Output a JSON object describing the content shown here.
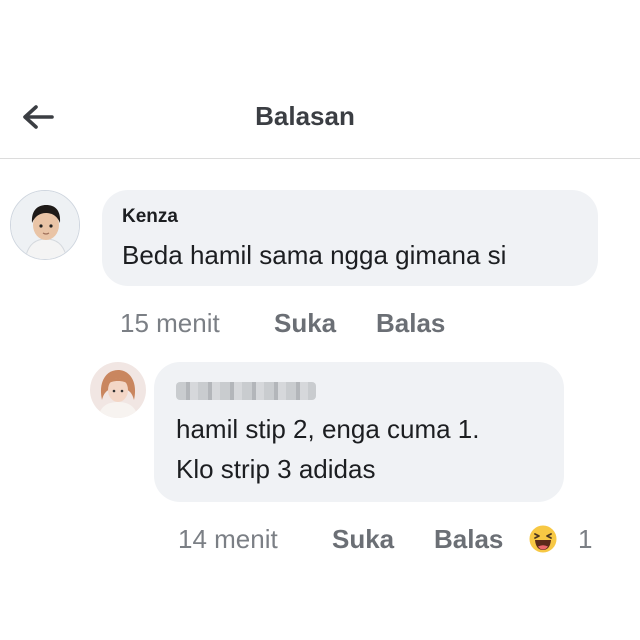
{
  "header": {
    "title": "Balasan",
    "back_icon": "arrow-left-icon"
  },
  "comments": [
    {
      "author": "Kenza",
      "lines": [
        "Beda hamil sama ngga gimana si"
      ],
      "time": "15 menit",
      "like_label": "Suka",
      "reply_label": "Balas"
    },
    {
      "author": "",
      "author_redacted": true,
      "lines": [
        "hamil stip 2, enga cuma 1.",
        "Klo strip 3 adidas"
      ],
      "time": "14 menit",
      "like_label": "Suka",
      "reply_label": "Balas",
      "reaction": {
        "icon": "haha-emoji-icon",
        "count": "1"
      }
    }
  ],
  "colors": {
    "bubble": "#f0f2f5",
    "meta_text": "#6b6f75",
    "divider": "#dcdcdc",
    "haha_yellow": "#f7c844"
  }
}
